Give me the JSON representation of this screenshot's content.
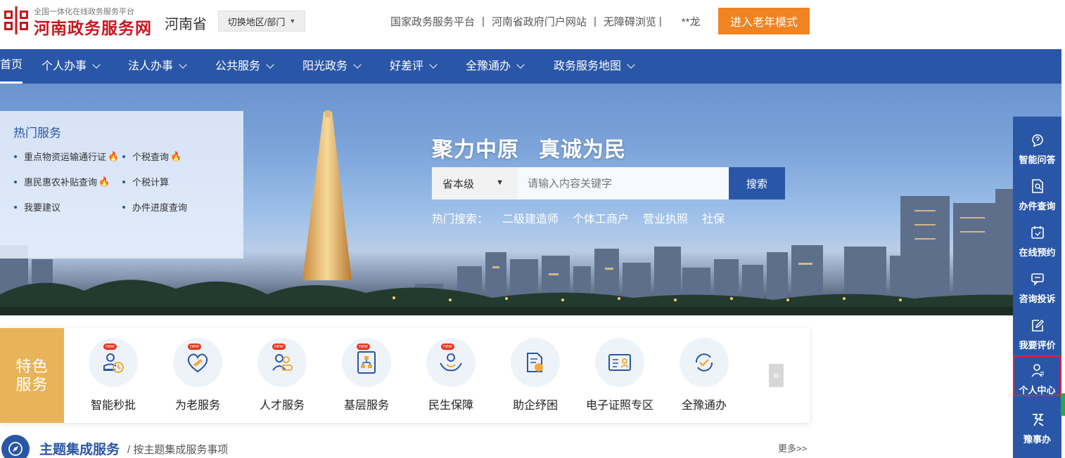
{
  "header": {
    "logo_subtitle": "全国一体化在线政务服务平台",
    "logo_title": "河南政务服务网",
    "region": "河南省",
    "switch_label": "切换地区/部门",
    "links": [
      "国家政务服务平台",
      "河南省政府门户网站",
      "无障碍浏览"
    ],
    "user": "**龙",
    "elder_mode": "进入老年模式"
  },
  "nav": {
    "items": [
      "首页",
      "个人办事",
      "法人办事",
      "公共服务",
      "阳光政务",
      "好差评",
      "全豫通办",
      "政务服务地图"
    ]
  },
  "hot_services": {
    "title": "热门服务",
    "items": [
      "重点物资运输通行证",
      "个税查询",
      "惠民惠农补贴查询",
      "个税计算",
      "我要建议",
      "办件进度查询"
    ]
  },
  "banner": {
    "slogan": "聚力中原   真诚为民",
    "search_level": "省本级",
    "search_placeholder": "请输入内容关键字",
    "search_button": "搜索",
    "hot_search_label": "热门搜索：",
    "hot_keywords": [
      "二级建造师",
      "个体工商户",
      "营业执照",
      "社保"
    ]
  },
  "featured": {
    "label_line1": "特色",
    "label_line2": "服务",
    "new_badge": "new",
    "services": [
      "智能秒批",
      "为老服务",
      "人才服务",
      "基层服务",
      "民生保障",
      "助企纾困",
      "电子证照专区",
      "全豫通办"
    ],
    "more_arrow": "»"
  },
  "theme": {
    "title": "主题集成服务",
    "subtitle": "/ 按主题集成服务事项",
    "more": "更多>>"
  },
  "sidebar": {
    "items": [
      "智能问答",
      "办件查询",
      "在线预约",
      "咨询投诉",
      "我要评价",
      "个人中心",
      "豫事办"
    ]
  },
  "colors": {
    "nav_blue": "#2a56a7",
    "orange": "#f08322",
    "logo_red": "#c8161d",
    "feature_gold": "#e9b459",
    "highlight_red": "#e8232e"
  }
}
